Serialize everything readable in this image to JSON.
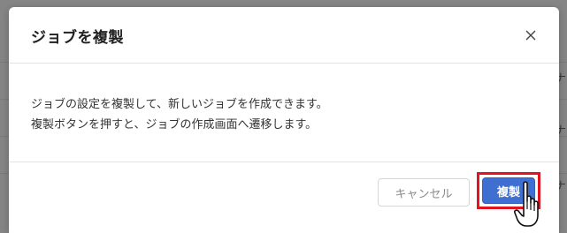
{
  "background": {
    "right_column_glyphs": [
      "ナ",
      "ナ",
      "ナ"
    ]
  },
  "dialog": {
    "title": "ジョブを複製",
    "close_label": "×",
    "body_lines": [
      "ジョブの設定を複製して、新しいジョブを作成できます。",
      "複製ボタンを押すと、ジョブの作成画面へ遷移します。"
    ],
    "buttons": {
      "cancel_label": "キャンセル",
      "duplicate_label": "複製"
    }
  },
  "colors": {
    "primary": "#3f6fd0",
    "highlight": "#e0141e"
  },
  "icons": {
    "close": "close-icon",
    "cursor": "hand-pointer-icon"
  }
}
